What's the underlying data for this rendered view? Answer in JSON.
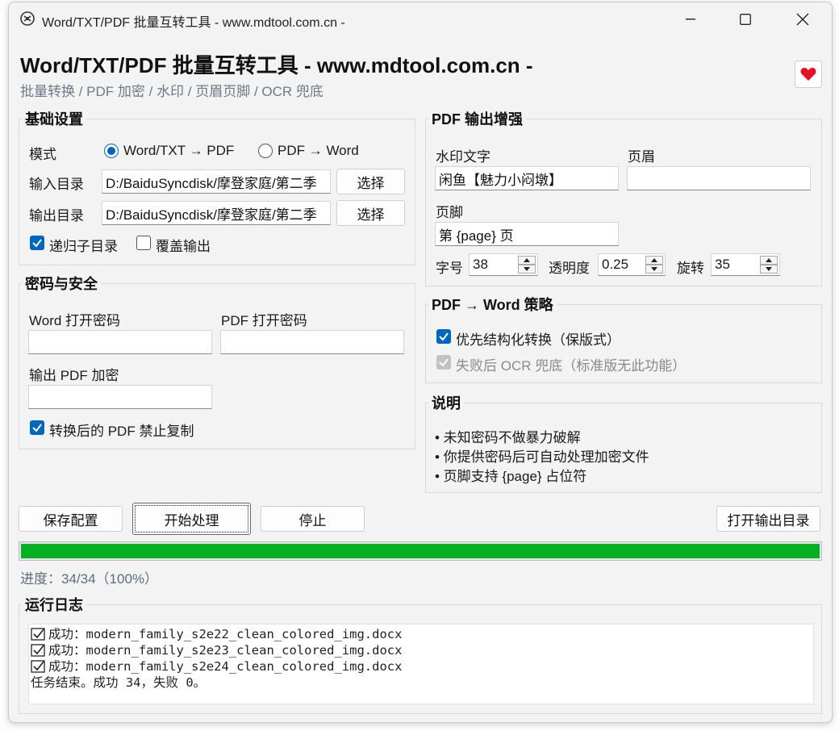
{
  "window": {
    "title": "Word/TXT/PDF 批量互转工具 - www.mdtool.com.cn -"
  },
  "header": {
    "title": "Word/TXT/PDF 批量互转工具 - www.mdtool.com.cn -",
    "subtitle": "批量转换 / PDF 加密 / 水印 / 页眉页脚 / OCR 兜底"
  },
  "basic": {
    "title": "基础设置",
    "mode_label": "模式",
    "mode_options": [
      "Word/TXT → PDF",
      "PDF → Word"
    ],
    "mode_selected": 0,
    "input_dir_label": "输入目录",
    "input_dir_value": "D:/BaiduSyncdisk/摩登家庭/第二季",
    "output_dir_label": "输出目录",
    "output_dir_value": "D:/BaiduSyncdisk/摩登家庭/第二季",
    "choose_label": "选择",
    "recursive_label": "递归子目录",
    "recursive_checked": true,
    "overwrite_label": "覆盖输出",
    "overwrite_checked": false
  },
  "security": {
    "title": "密码与安全",
    "word_pwd_label": "Word 打开密码",
    "word_pwd_value": "",
    "pdf_pwd_label": "PDF 打开密码",
    "pdf_pwd_value": "",
    "out_pdf_label": "输出 PDF 加密",
    "out_pdf_value": "",
    "no_copy_label": "转换后的 PDF 禁止复制",
    "no_copy_checked": true
  },
  "pdf_enhance": {
    "title": "PDF 输出增强",
    "watermark_label": "水印文字",
    "watermark_value": "闲鱼【魅力小闷墩】",
    "header_label": "页眉",
    "header_value": "",
    "footer_label": "页脚",
    "footer_value": "第 {page} 页",
    "font_size_label": "字号",
    "font_size_value": "38",
    "opacity_label": "透明度",
    "opacity_value": "0.25",
    "rotate_label": "旋转",
    "rotate_value": "35"
  },
  "strategy": {
    "title": "PDF → Word 策略",
    "structured_label": "优先结构化转换（保版式）",
    "structured_checked": true,
    "ocr_label": "失败后 OCR 兜底（标准版无此功能）",
    "ocr_checked": true,
    "ocr_disabled": true
  },
  "notes": {
    "title": "说明",
    "items": [
      "• 未知密码不做暴力破解",
      "• 你提供密码后可自动处理加密文件",
      "• 页脚支持 {page} 占位符"
    ]
  },
  "actions": {
    "save_label": "保存配置",
    "start_label": "开始处理",
    "stop_label": "停止",
    "open_output_label": "打开输出目录"
  },
  "progress": {
    "fraction": 1.0,
    "text": "进度：34/34（100%）",
    "color": "#06b025"
  },
  "log": {
    "title": "运行日志",
    "lines": [
      {
        "icon": "check",
        "text": "成功：modern_family_s2e22_clean_colored_img.docx"
      },
      {
        "icon": "check",
        "text": "成功：modern_family_s2e23_clean_colored_img.docx"
      },
      {
        "icon": "check",
        "text": "成功：modern_family_s2e24_clean_colored_img.docx"
      },
      {
        "icon": "",
        "text": "任务结束。成功 34，失败 0。"
      }
    ]
  },
  "colors": {
    "accent": "#0067c0",
    "heart": "#e81123"
  }
}
